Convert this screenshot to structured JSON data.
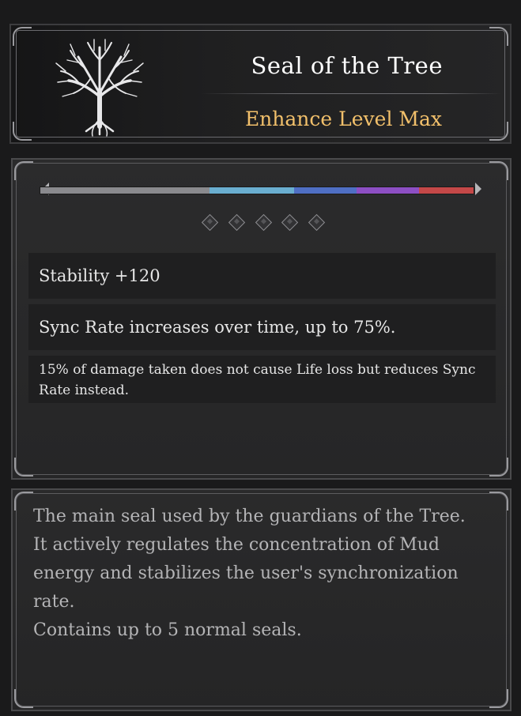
{
  "item": {
    "name": "Seal of the Tree",
    "enhance_level": "Enhance Level Max",
    "emblem_icon": "white-tree-emblem-icon"
  },
  "sync_bar": {
    "segments": [
      {
        "color": "#8a8a8e",
        "fraction": 0.39
      },
      {
        "color": "#6aaed0",
        "fraction": 0.195
      },
      {
        "color": "#4f6fc4",
        "fraction": 0.145
      },
      {
        "color": "#8d4fc4",
        "fraction": 0.145
      },
      {
        "color": "#c44848",
        "fraction": 0.125
      }
    ]
  },
  "seal_slots": {
    "count": 5,
    "icon": "empty-diamond-slot-icon"
  },
  "stats": {
    "stability": "Stability +120",
    "sync_rate": "Sync Rate increases over time, up to 75%.",
    "damage_effect": "15% of damage taken does not cause Life loss but reduces Sync Rate instead."
  },
  "description": {
    "line1": "The main seal used by the guardians of the Tree.",
    "line2": "It actively regulates the concentration of Mud energy and stabilizes the user's synchronization rate.",
    "line3": "Contains up to 5 normal seals."
  },
  "colors": {
    "title": "#ffffff",
    "enhance_level": "#f2c06b"
  }
}
